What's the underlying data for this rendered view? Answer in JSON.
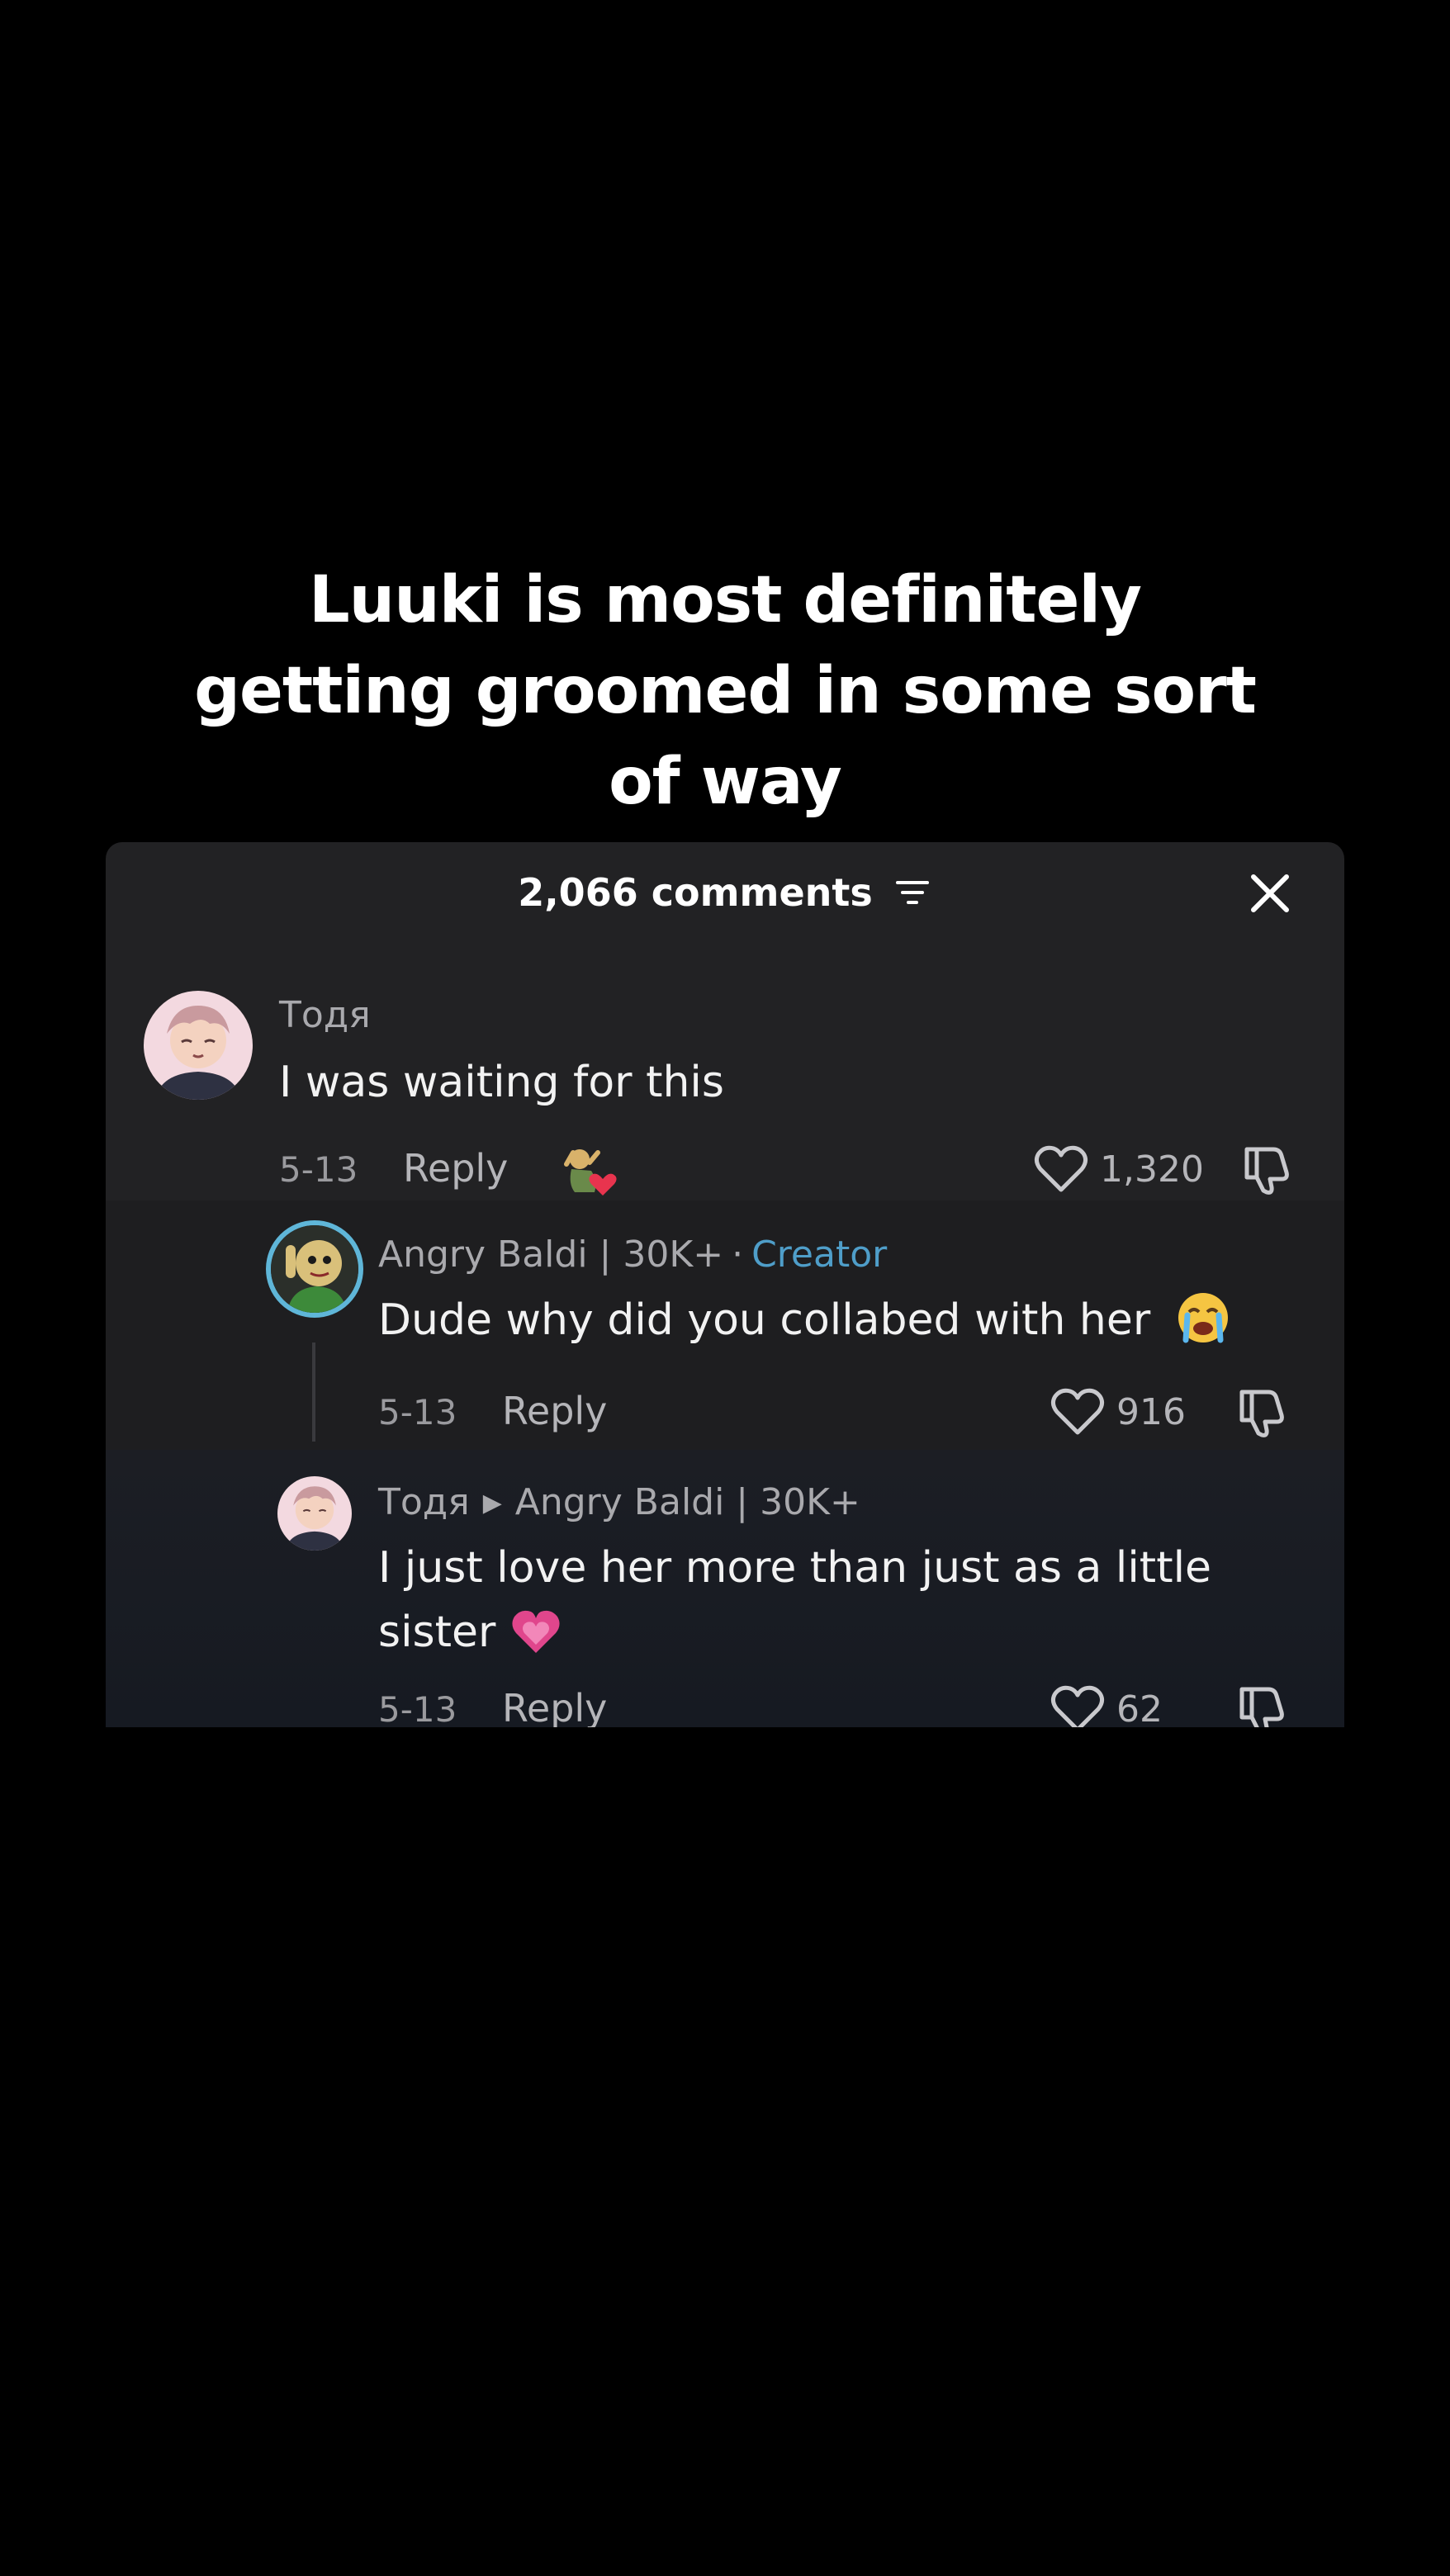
{
  "caption": "Luuki is most definitely getting groomed in some sort of way",
  "header": {
    "comments_count": "2,066 comments"
  },
  "comments": [
    {
      "author": "Тодя",
      "text": "I was waiting for this",
      "date": "5-13",
      "reply_label": "Reply",
      "likes": "1,320",
      "creator_liked_icon": "creator-liked-heart-icon"
    },
    {
      "author": "Angry Baldi | 30K+",
      "badge_separator": "·",
      "badge": "Creator",
      "text": "Dude why did you collabed with her",
      "emoji": "loudly-crying-face-emoji",
      "date": "5-13",
      "reply_label": "Reply",
      "likes": "916"
    },
    {
      "author": "Тодя",
      "reply_to": "Angry Baldi | 30K+",
      "text_line1": "I just love her more than just as a little",
      "text_line2": "sister",
      "emoji": "pink-heart-emoji",
      "date": "5-13",
      "reply_label": "Reply",
      "likes": "62"
    }
  ],
  "colors": {
    "background": "#000000",
    "panel": "#222224",
    "creator_badge": "#4f9ec9",
    "muted_text": "#a9a9ad"
  }
}
